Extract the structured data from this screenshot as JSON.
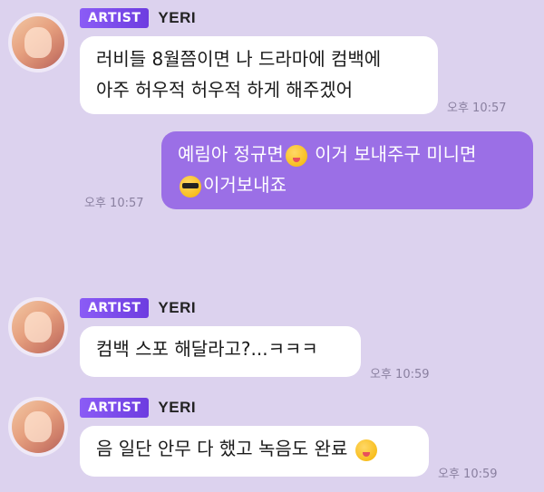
{
  "chat": {
    "messages": [
      {
        "sender": {
          "badge": "ARTIST",
          "name": "YERI"
        },
        "lines": [
          "러비들 8월쯤이면 나 드라마에 컴백에",
          "아주 허우적 허우적 하게 해주겠어"
        ],
        "time": "오후 10:57"
      },
      {
        "mine": true,
        "line1_a": "예림아 정규면",
        "line1_b": "이거 보내주구 미니면",
        "line2": "이거보내죠",
        "emoji1": "yum-face-emoji",
        "emoji2": "sunglasses-face-emoji",
        "time": "오후 10:57"
      },
      {
        "sender": {
          "badge": "ARTIST",
          "name": "YERI"
        },
        "text": "컴백 스포 해달라고?...ㅋㅋㅋ",
        "time": "오후 10:59"
      },
      {
        "sender": {
          "badge": "ARTIST",
          "name": "YERI"
        },
        "text": "음 일단 안무 다 했고 녹음도 완료",
        "emoji": "yum-face-emoji",
        "time": "오후 10:59"
      }
    ]
  },
  "colors": {
    "background": "#dcd2ee",
    "my_bubble": "#9b6fe6",
    "artist_badge": "#7c4dea"
  }
}
